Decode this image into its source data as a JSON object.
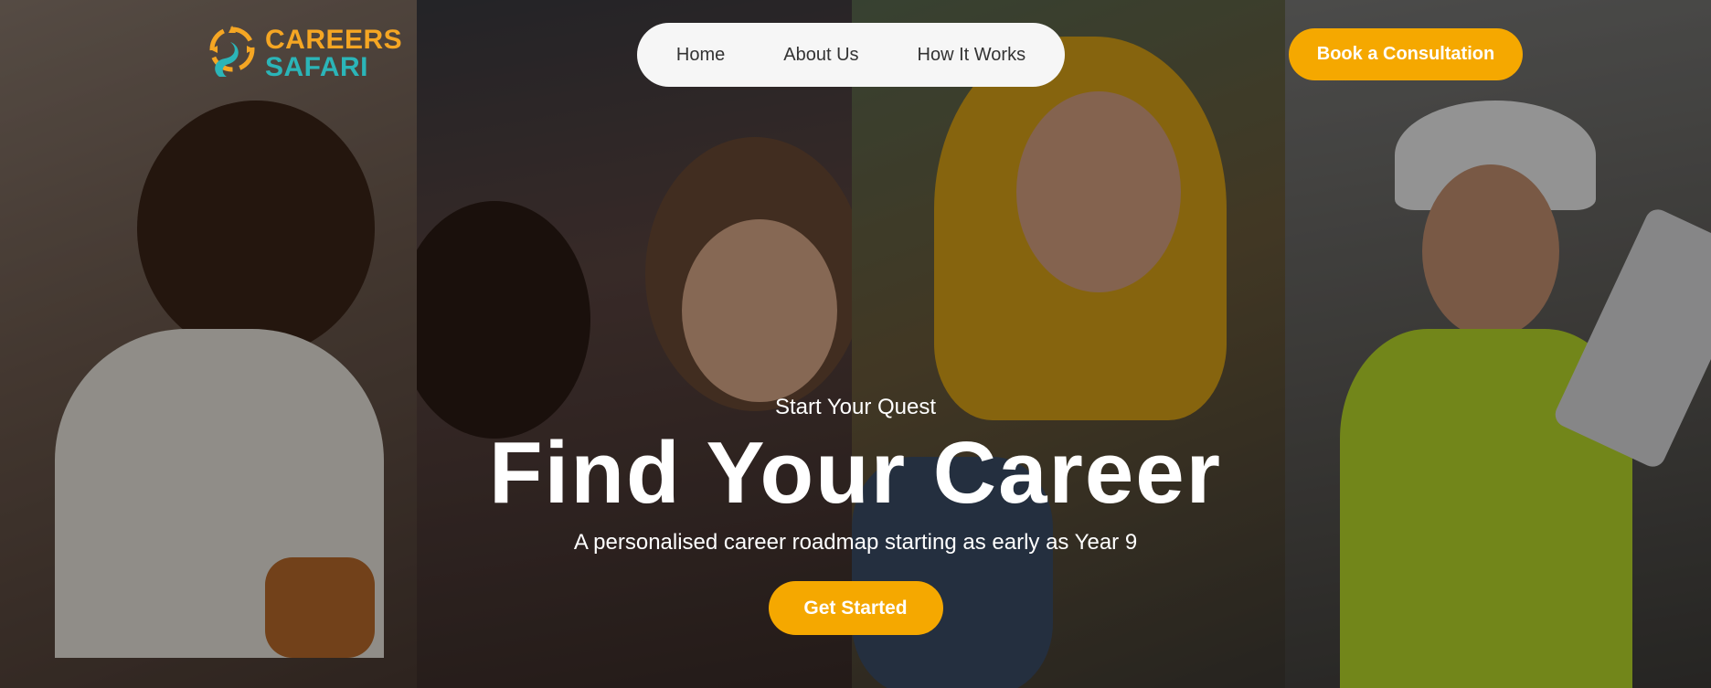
{
  "brand": {
    "name_line1": "CAREERS",
    "name_line2": "SAFARI",
    "primary_color": "#f5a623",
    "secondary_color": "#2bb5b8"
  },
  "nav": {
    "items": [
      {
        "label": "Home"
      },
      {
        "label": "About Us"
      },
      {
        "label": "How It Works"
      }
    ]
  },
  "header_cta": {
    "label": "Book a Consultation"
  },
  "hero": {
    "kicker": "Start Your Quest",
    "headline": "Find Your Career",
    "subheadline": "A personalised career roadmap starting as early as Year 9",
    "cta_label": "Get Started",
    "accent_color": "#f5a800"
  },
  "images": [
    {
      "description": "student-writing"
    },
    {
      "description": "two-students-laughing"
    },
    {
      "description": "student-in-yellow-hijab"
    },
    {
      "description": "worker-in-hard-hat"
    }
  ]
}
